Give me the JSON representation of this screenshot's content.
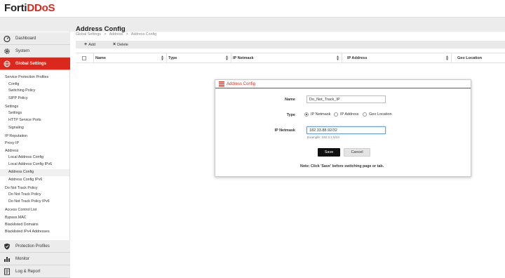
{
  "app": {
    "logo_prefix": "Forti",
    "logo_suffix": "DDoS"
  },
  "colors": {
    "accent": "#da291c",
    "sidebar_bg": "#ececec"
  },
  "sidebar": {
    "top_items": [
      {
        "label": "Dashboard",
        "icon": "dashboard-icon"
      },
      {
        "label": "System",
        "icon": "gear-icon"
      },
      {
        "label": "Global Settings",
        "icon": "globe-icon",
        "active": true
      }
    ],
    "tree": [
      {
        "label": "Service Protection Profiles",
        "level": 0
      },
      {
        "label": "Config",
        "level": 1
      },
      {
        "label": "Switching Policy",
        "level": 1
      },
      {
        "label": "SIPP Policy",
        "level": 1
      },
      {
        "label": "Settings",
        "level": 0
      },
      {
        "label": "Settings",
        "level": 1
      },
      {
        "label": "HTTP Service Ports",
        "level": 1
      },
      {
        "label": "Signaling",
        "level": 1
      },
      {
        "label": "IP Reputation",
        "level": 0
      },
      {
        "label": "Proxy IP",
        "level": 0
      },
      {
        "label": "Address",
        "level": 0
      },
      {
        "label": "Local Address Config",
        "level": 1
      },
      {
        "label": "Local Address Config IPv6",
        "level": 1
      },
      {
        "label": "Address Config",
        "level": 1,
        "selected": true
      },
      {
        "label": "Address Config IPv6",
        "level": 1
      },
      {
        "label": "Do Not Track Policy",
        "level": 0
      },
      {
        "label": "Do Not Track Policy",
        "level": 1
      },
      {
        "label": "Do Not Track Policy IPv6",
        "level": 1
      },
      {
        "label": "Access Control List",
        "level": 0
      },
      {
        "label": "Bypass MAC",
        "level": 0
      },
      {
        "label": "Blacklisted Domains",
        "level": 0
      },
      {
        "label": "Blacklisted IPv4 Addresses",
        "level": 0
      }
    ],
    "bottom_items": [
      {
        "label": "Protection Profiles",
        "icon": "shield-icon"
      },
      {
        "label": "Monitor",
        "icon": "chart-icon"
      },
      {
        "label": "Log & Report",
        "icon": "report-icon"
      }
    ]
  },
  "main": {
    "title": "Address Config",
    "breadcrumb": [
      "Global Settings",
      ">",
      "Address",
      ">",
      "Address Config"
    ],
    "toolbar": {
      "add_label": "Add",
      "delete_label": "Delete"
    },
    "columns": [
      "Name",
      "Type",
      "IP Netmask",
      "IP Address",
      "Geo Location"
    ]
  },
  "dialog": {
    "title": "Address Config",
    "name_label": "Name",
    "name_value": "Do_Not_Track_IP",
    "type_label": "Type",
    "type_options": [
      {
        "label": "IP Netmask",
        "checked": true
      },
      {
        "label": "IP Address",
        "checked": false
      },
      {
        "label": "Geo Location",
        "checked": false
      }
    ],
    "netmask_label": "IP Netmask",
    "netmask_value": "182.33.88.92/32",
    "netmask_example": "Example: 192.3.2.5/24",
    "save_label": "Save",
    "cancel_label": "Cancel",
    "note": "Note: Click 'Save' before switching page or tab."
  }
}
